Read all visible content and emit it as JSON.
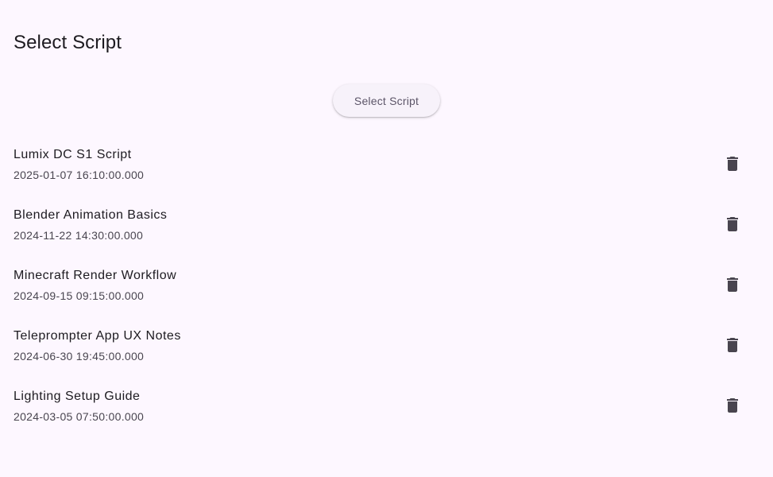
{
  "header": {
    "title": "Select Script"
  },
  "actions": {
    "select_button_label": "Select Script"
  },
  "scripts": [
    {
      "title": "Lumix DC S1 Script",
      "timestamp": "2025-01-07 16:10:00.000",
      "action_icon": "delete-icon"
    },
    {
      "title": "Blender Animation Basics",
      "timestamp": "2024-11-22 14:30:00.000",
      "action_icon": "delete-icon"
    },
    {
      "title": "Minecraft Render Workflow",
      "timestamp": "2024-09-15 09:15:00.000",
      "action_icon": "delete-icon"
    },
    {
      "title": "Teleprompter App UX Notes",
      "timestamp": "2024-06-30 19:45:00.000",
      "action_icon": "delete-icon"
    },
    {
      "title": "Lighting Setup Guide",
      "timestamp": "2024-03-05 07:50:00.000",
      "action_icon": "delete-icon"
    }
  ],
  "colors": {
    "background": "#fdf7ff",
    "text_primary": "#1d1b20",
    "text_secondary": "#49454f",
    "button_surface": "#f7f2fa"
  }
}
